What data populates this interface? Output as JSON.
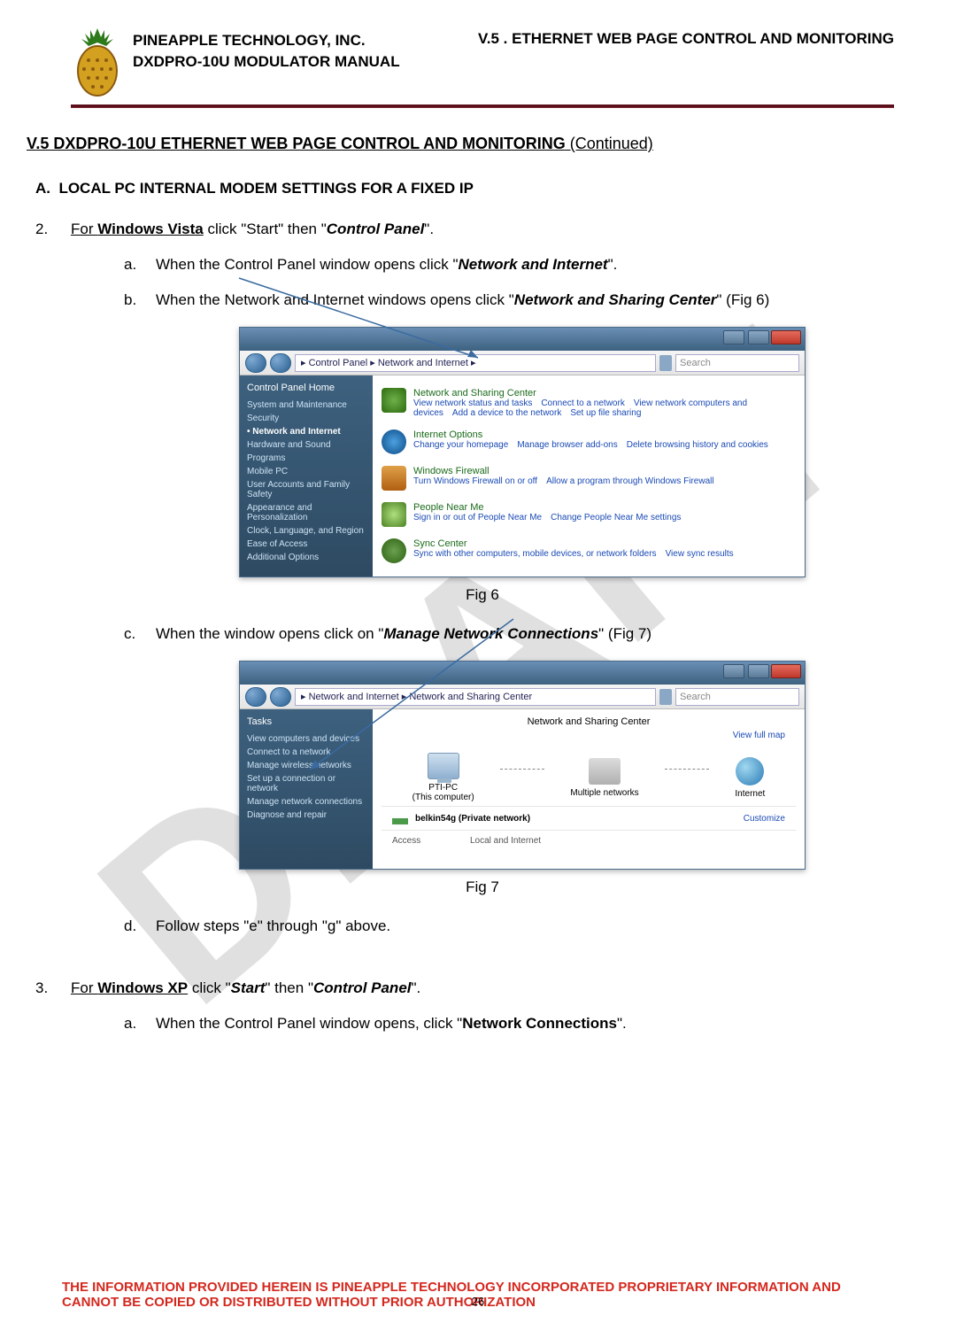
{
  "header": {
    "company": "PINEAPPLE TECHNOLOGY, INC.",
    "manual": "DXDPRO-10U MODULATOR MANUAL",
    "section_header": "V.5 . ETHERNET WEB PAGE CONTROL AND MONITORING"
  },
  "title": {
    "main": "V.5  DXDPRO-10U ETHERNET WEB PAGE CONTROL AND MONITORING",
    "suffix": " (Continued)"
  },
  "sectionA": {
    "label": "A.",
    "text": "LOCAL PC INTERNAL MODEM SETTINGS FOR A FIXED IP"
  },
  "step2": {
    "num": "2.",
    "prefix": "For ",
    "os": "Windows Vista",
    "mid": " click \"Start\" then \"",
    "bi": "Control Panel",
    "suffix": "\"."
  },
  "step2a": {
    "let": "a.",
    "pre": "When the Control Panel window opens click \"",
    "bi": "Network and Internet",
    "post": "\"."
  },
  "step2b": {
    "let": "b.",
    "pre": "When the Network and Internet windows opens click \"",
    "bi": "Network and Sharing Center",
    "post": "\" (Fig 6)"
  },
  "fig6": {
    "caption": "Fig 6",
    "breadcrumb": "▸ Control Panel ▸ Network and Internet ▸",
    "search": "Search",
    "side_header": "Control Panel Home",
    "side_items": [
      "System and Maintenance",
      "Security",
      "Network and Internet",
      "Hardware and Sound",
      "Programs",
      "Mobile PC",
      "User Accounts and Family Safety",
      "Appearance and Personalization",
      "Clock, Language, and Region",
      "Ease of Access",
      "Additional Options"
    ],
    "cats": [
      {
        "title": "Network and Sharing Center",
        "links": [
          "View network status and tasks",
          "Connect to a network",
          "View network computers and devices",
          "Add a device to the network",
          "Set up file sharing"
        ]
      },
      {
        "title": "Internet Options",
        "links": [
          "Change your homepage",
          "Manage browser add-ons",
          "Delete browsing history and cookies"
        ]
      },
      {
        "title": "Windows Firewall",
        "links": [
          "Turn Windows Firewall on or off",
          "Allow a program through Windows Firewall"
        ]
      },
      {
        "title": "People Near Me",
        "links": [
          "Sign in or out of People Near Me",
          "Change People Near Me settings"
        ]
      },
      {
        "title": "Sync Center",
        "links": [
          "Sync with other computers, mobile devices, or network folders",
          "View sync results"
        ]
      }
    ]
  },
  "step2c": {
    "let": "c.",
    "pre": "When the window opens click on \"",
    "bi": "Manage Network Connections",
    "post": "\" (Fig 7)"
  },
  "fig7": {
    "caption": "Fig 7",
    "breadcrumb": "▸ Network and Internet ▸ Network and Sharing Center",
    "search": "Search",
    "tasks_header": "Tasks",
    "tasks": [
      "View computers and devices",
      "Connect to a network",
      "Manage wireless networks",
      "Set up a connection or network",
      "Manage network connections",
      "Diagnose and repair"
    ],
    "main_title": "Network and Sharing Center",
    "fullmap": "View full map",
    "nodes": [
      "PTI-PC\n(This computer)",
      "Multiple networks",
      "Internet"
    ],
    "network_name": "belkin54g (Private network)",
    "customize": "Customize",
    "row2_l": "Access",
    "row2_r": "Local and Internet"
  },
  "step2d": {
    "let": "d.",
    "text": "Follow steps \"e\" through \"g\" above."
  },
  "step3": {
    "num": "3.",
    "prefix": "For ",
    "os": "Windows XP",
    "mid": " click \"",
    "bi1": "Start",
    "mid2": "\" then \"",
    "bi2": "Control Panel",
    "suffix": "\"."
  },
  "step3a": {
    "let": "a.",
    "pre": "When the Control Panel window opens, click \"",
    "b": "Network Connections",
    "post": "\"."
  },
  "footer": {
    "line": "THE INFORMATION PROVIDED HEREIN IS PINEAPPLE TECHNOLOGY INCORPORATED PROPRIETARY INFORMATION AND CANNOT BE COPIED OR DISTRIBUTED WITHOUT PRIOR AUTHORIZATION",
    "page": "26"
  }
}
